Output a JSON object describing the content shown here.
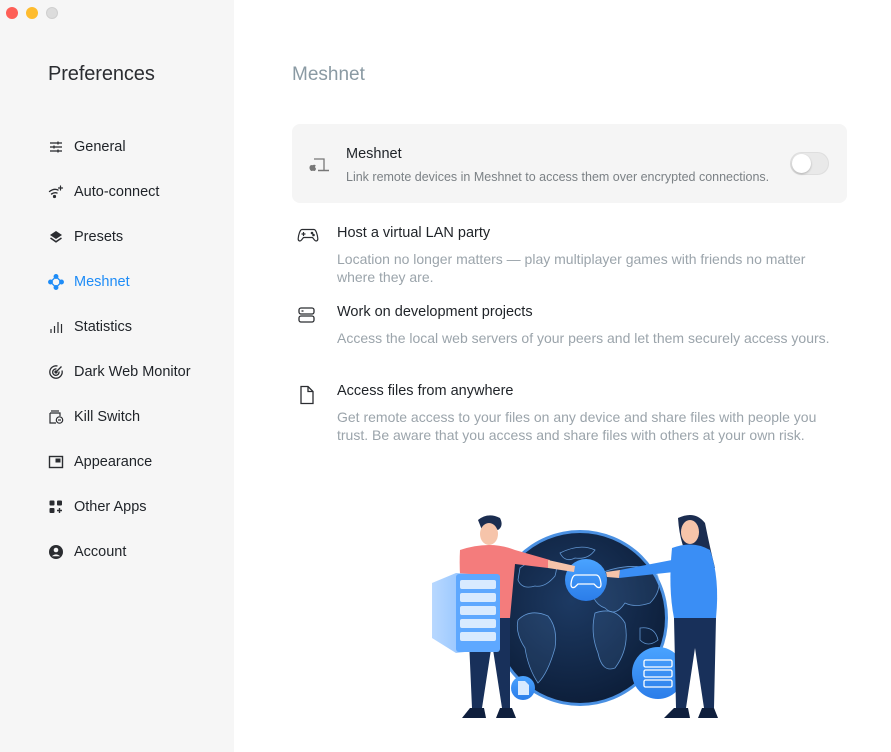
{
  "window": {
    "controls": [
      "close",
      "minimize",
      "maximize"
    ]
  },
  "sidebar": {
    "title": "Preferences",
    "active_item": "Meshnet",
    "accent_color": "#1e8cf7",
    "items": [
      {
        "label": "General",
        "icon": "sliders-icon"
      },
      {
        "label": "Auto-connect",
        "icon": "wifi-sparkle-icon"
      },
      {
        "label": "Presets",
        "icon": "layers-icon"
      },
      {
        "label": "Meshnet",
        "icon": "meshnet-icon"
      },
      {
        "label": "Statistics",
        "icon": "bar-chart-icon"
      },
      {
        "label": "Dark Web Monitor",
        "icon": "radar-icon"
      },
      {
        "label": "Kill Switch",
        "icon": "kill-switch-icon"
      },
      {
        "label": "Appearance",
        "icon": "appearance-icon"
      },
      {
        "label": "Other Apps",
        "icon": "apps-grid-icon"
      },
      {
        "label": "Account",
        "icon": "account-icon"
      }
    ]
  },
  "main": {
    "title": "Meshnet",
    "meshnet_card": {
      "title": "Meshnet",
      "description": "Link remote devices in Meshnet to access them over encrypted connections.",
      "icon": "device-laptop-icon",
      "toggle_on": false
    },
    "features": [
      {
        "icon": "gamepad-icon",
        "title": "Host a virtual LAN party",
        "description": "Location no longer matters — play multiplayer games with friends no matter where they are."
      },
      {
        "icon": "server-icon",
        "title": "Work on development projects",
        "description": "Access the local web servers of your peers and let them securely access yours."
      },
      {
        "icon": "file-icon",
        "title": "Access files from anywhere",
        "description": "Get remote access to your files on any device and share files with people you trust. Be aware that you access and share files with others at your own risk."
      }
    ],
    "illustration": "meshnet-globe-illustration"
  }
}
